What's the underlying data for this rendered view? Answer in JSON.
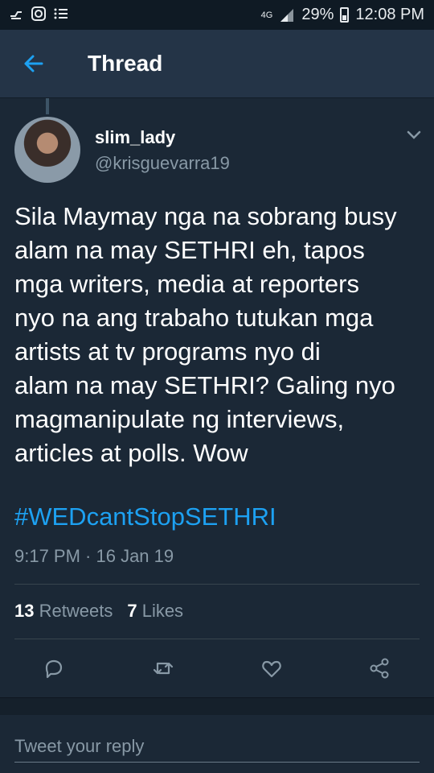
{
  "status_bar": {
    "network": "4G",
    "battery_percent": "29%",
    "time": "12:08 PM"
  },
  "header": {
    "title": "Thread"
  },
  "tweet": {
    "display_name": "slim_lady",
    "handle": "@krisguevarra19",
    "text": "Sila Maymay nga na sobrang busy\nalam na may SETHRI eh, tapos\nmga writers, media at reporters\nnyo na ang trabaho tutukan mga\nartists at tv programs nyo di\nalam na may SETHRI? Galing nyo\nmagmanipulate ng interviews,\narticles at polls. Wow",
    "hashtag": "#WEDcantStopSETHRI",
    "timestamp": "9:17 PM · 16 Jan 19",
    "retweet_count": "13",
    "retweet_label": "Retweets",
    "like_count": "7",
    "like_label": "Likes"
  },
  "reply": {
    "placeholder": "Tweet your reply"
  },
  "colors": {
    "background": "#1b2836",
    "header": "#243447",
    "accent": "#1da1f2",
    "secondary_text": "#8899a6"
  },
  "icons": [
    "download-icon",
    "instagram-icon",
    "list-icon",
    "signal-icon",
    "battery-icon",
    "back-arrow-icon",
    "chevron-down-icon",
    "reply-icon",
    "retweet-icon",
    "like-icon",
    "share-icon"
  ]
}
